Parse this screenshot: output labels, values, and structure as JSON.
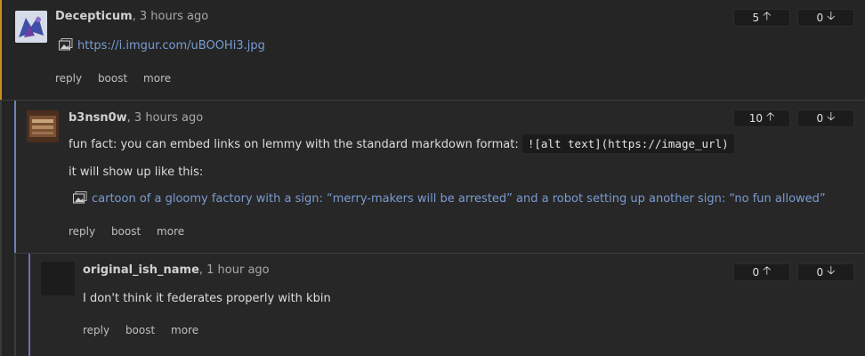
{
  "comments": [
    {
      "username": "Decepticum",
      "time": ", 3 hours ago",
      "link_text": "https://i.imgur.com/uBOOHi3.jpg",
      "upvotes": "5",
      "downvotes": "0",
      "actions": [
        "reply",
        "boost",
        "more"
      ]
    },
    {
      "username": "b3nsn0w",
      "time": ", 3 hours ago",
      "text_before_code": "fun fact: you can embed links on lemmy with the standard markdown format:",
      "code": "![alt text](https://image_url)",
      "text_line2": "it will show up like this:",
      "link_text": "cartoon of a gloomy factory with a sign: “merry-makers will be arrested” and a robot setting up another sign: “no fun allowed”",
      "upvotes": "10",
      "downvotes": "0",
      "actions": [
        "reply",
        "boost",
        "more"
      ]
    },
    {
      "username": "original_ish_name",
      "time": ", 1 hour ago",
      "text": "I don't think it federates properly with kbin",
      "upvotes": "0",
      "downvotes": "0",
      "actions": [
        "reply",
        "boost",
        "more"
      ]
    }
  ],
  "icons": {
    "upvote": "arrow-up-icon",
    "downvote": "arrow-down-icon",
    "image": "image-icon"
  },
  "colors": {
    "link": "#7a9bd1",
    "rail_level1": "#c6901c",
    "rail_level2": "#6f83b5",
    "rail_level3": "#6f6fb5"
  }
}
